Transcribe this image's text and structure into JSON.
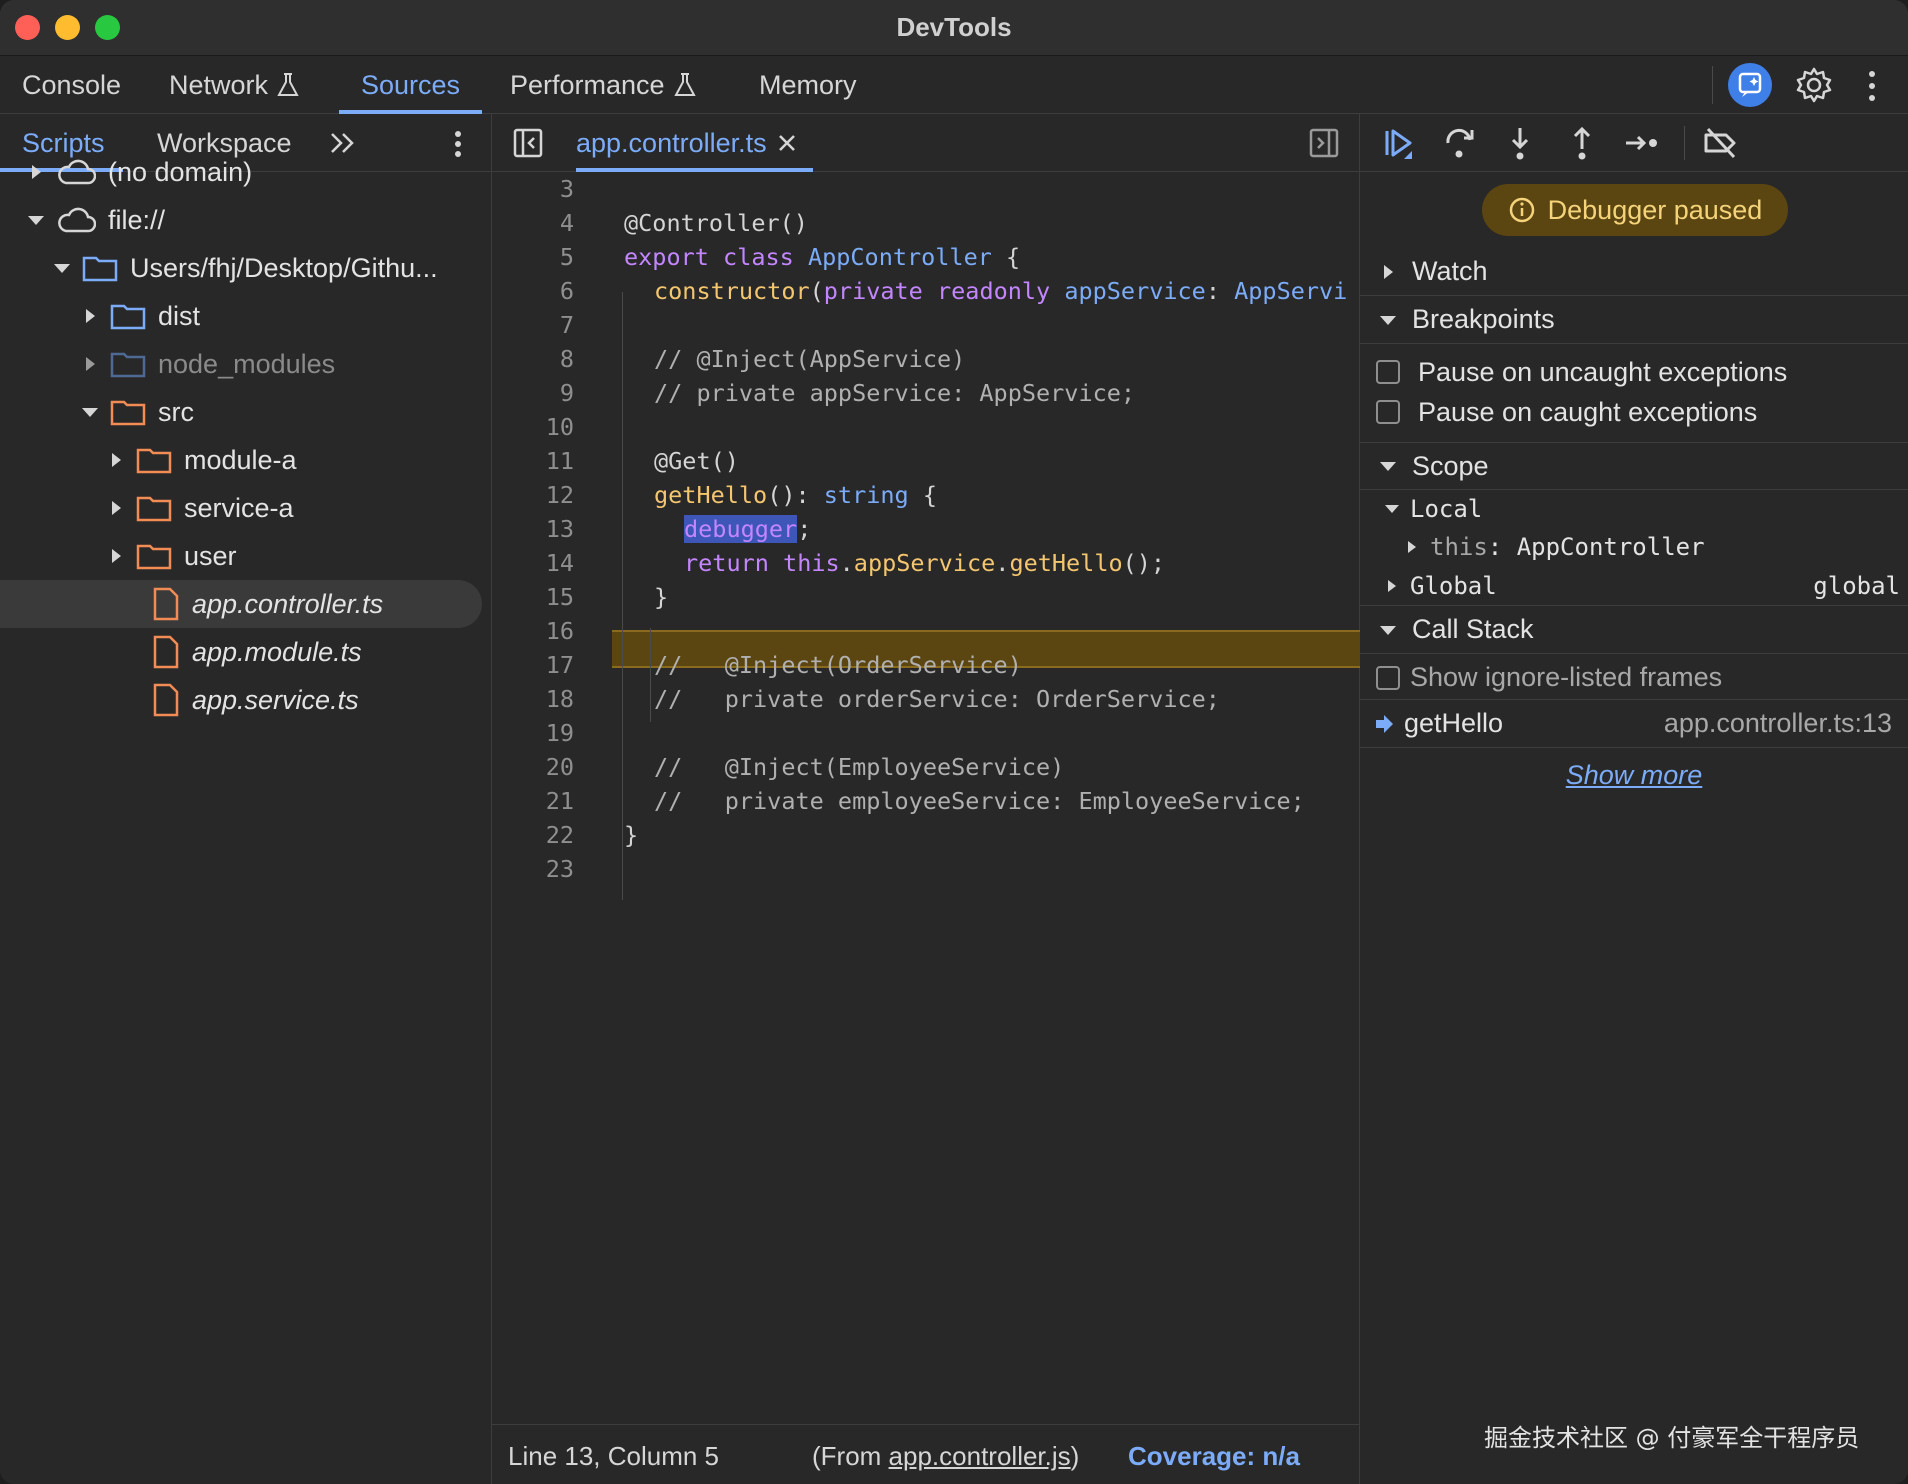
{
  "window": {
    "title": "DevTools"
  },
  "main_tabs": [
    {
      "label": "Console"
    },
    {
      "label": "Network"
    },
    {
      "label": "Sources"
    },
    {
      "label": "Performance"
    },
    {
      "label": "Memory"
    }
  ],
  "navigator": {
    "tabs": [
      {
        "label": "Scripts"
      },
      {
        "label": "Workspace"
      }
    ],
    "tree": [
      {
        "label": "(no domain)"
      },
      {
        "label": "file://"
      },
      {
        "label": "Users/fhj/Desktop/Githu..."
      },
      {
        "label": "dist"
      },
      {
        "label": "node_modules"
      },
      {
        "label": "src"
      },
      {
        "label": "module-a"
      },
      {
        "label": "service-a"
      },
      {
        "label": "user"
      },
      {
        "label": "app.controller.ts"
      },
      {
        "label": "app.module.ts"
      },
      {
        "label": "app.service.ts"
      }
    ]
  },
  "editor": {
    "file_tab": "app.controller.ts",
    "lines": [
      {
        "n": "3"
      },
      {
        "n": "4"
      },
      {
        "n": "5"
      },
      {
        "n": "6"
      },
      {
        "n": "7"
      },
      {
        "n": "8"
      },
      {
        "n": "9"
      },
      {
        "n": "10"
      },
      {
        "n": "11"
      },
      {
        "n": "12"
      },
      {
        "n": "13"
      },
      {
        "n": "14"
      },
      {
        "n": "15"
      },
      {
        "n": "16"
      },
      {
        "n": "17"
      },
      {
        "n": "18"
      },
      {
        "n": "19"
      },
      {
        "n": "20"
      },
      {
        "n": "21"
      },
      {
        "n": "22"
      },
      {
        "n": "23"
      }
    ],
    "code": {
      "l4": "@Controller()",
      "l5_kw1": "export",
      "l5_kw2": "class",
      "l5_ty": "AppController",
      "l5_rest": " {",
      "l6_fn": "constructor",
      "l6_p1": "(",
      "l6_kw1": "private",
      "l6_kw2": "readonly",
      "l6_ty1": "appService",
      "l6_p2": ": ",
      "l6_ty2": "AppServi",
      "l8": "// @Inject(AppService)",
      "l9": "// private appService: AppService;",
      "l11": "@Get()",
      "l12_fn": "getHello",
      "l12_p": "(): ",
      "l12_ty": "string",
      "l12_rest": " {",
      "l13_sel": "debugger",
      "l13_rest": ";",
      "l14_kw1": "return",
      "l14_kw2": "this",
      "l14_p1": ".",
      "l14_fn1": "appService",
      "l14_p2": ".",
      "l14_fn2": "getHello",
      "l14_rest": "();",
      "l15": "}",
      "l17": "//   @Inject(OrderService)",
      "l18": "//   private orderService: OrderService;",
      "l20": "//   @Inject(EmployeeService)",
      "l21": "//   private employeeService: EmployeeService;",
      "l22": "}"
    },
    "status": {
      "position": "Line 13, Column 5",
      "from_prefix": "(From ",
      "from_file": "app.controller.js",
      "from_suffix": ")",
      "coverage": "Coverage: n/a"
    }
  },
  "debugger": {
    "paused_label": "Debugger paused",
    "sections": {
      "watch": "Watch",
      "breakpoints": "Breakpoints",
      "scope": "Scope",
      "call_stack": "Call Stack"
    },
    "breakpoint_options": [
      {
        "label": "Pause on uncaught exceptions"
      },
      {
        "label": "Pause on caught exceptions"
      }
    ],
    "scope": {
      "local_label": "Local",
      "this_key": "this",
      "this_sep": ": ",
      "this_value": "AppController",
      "global_label": "Global",
      "global_value": "global"
    },
    "call_stack": {
      "show_ignore_listed": "Show ignore-listed frames",
      "frames": [
        {
          "name": "getHello",
          "location": "app.controller.ts:13"
        }
      ],
      "show_more": "Show more"
    }
  },
  "watermark": "掘金技术社区 @ 付豪军全干程序员",
  "colors": {
    "accent": "#7cacf8",
    "keyword": "#c386ff",
    "function": "#f4c66f",
    "paused_bg": "#5b4511",
    "paused_text": "#f4d37a",
    "file_icon": "#f28b54",
    "folder_icon": "#7cacf8"
  }
}
